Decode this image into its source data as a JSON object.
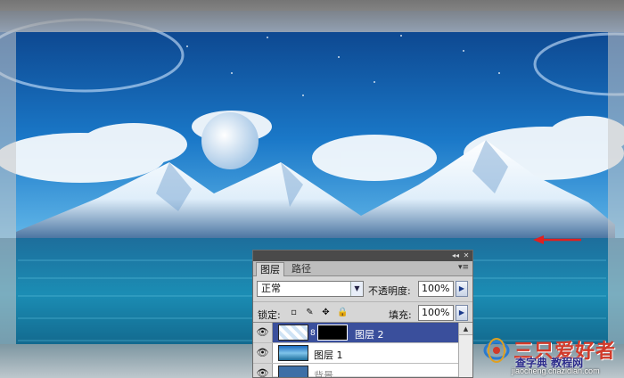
{
  "canvas": {
    "arrow_color": "#e02020"
  },
  "layers_panel": {
    "tabs": [
      {
        "label": "图层"
      },
      {
        "label": "路径"
      }
    ],
    "blend_mode": "正常",
    "opacity_label": "不透明度:",
    "opacity_value": "100%",
    "lock_label": "锁定:",
    "fill_label": "填充:",
    "fill_value": "100%",
    "layers": [
      {
        "name": "图层 2",
        "selected": true
      },
      {
        "name": "图层 1",
        "selected": false
      },
      {
        "name": "背景",
        "selected": false
      }
    ],
    "selection_color": "#3a4f9c"
  },
  "watermark": {
    "brand": "三只爱好者",
    "sub": "查字典 教程网",
    "url": "jiaocheng.chazidian.com"
  }
}
